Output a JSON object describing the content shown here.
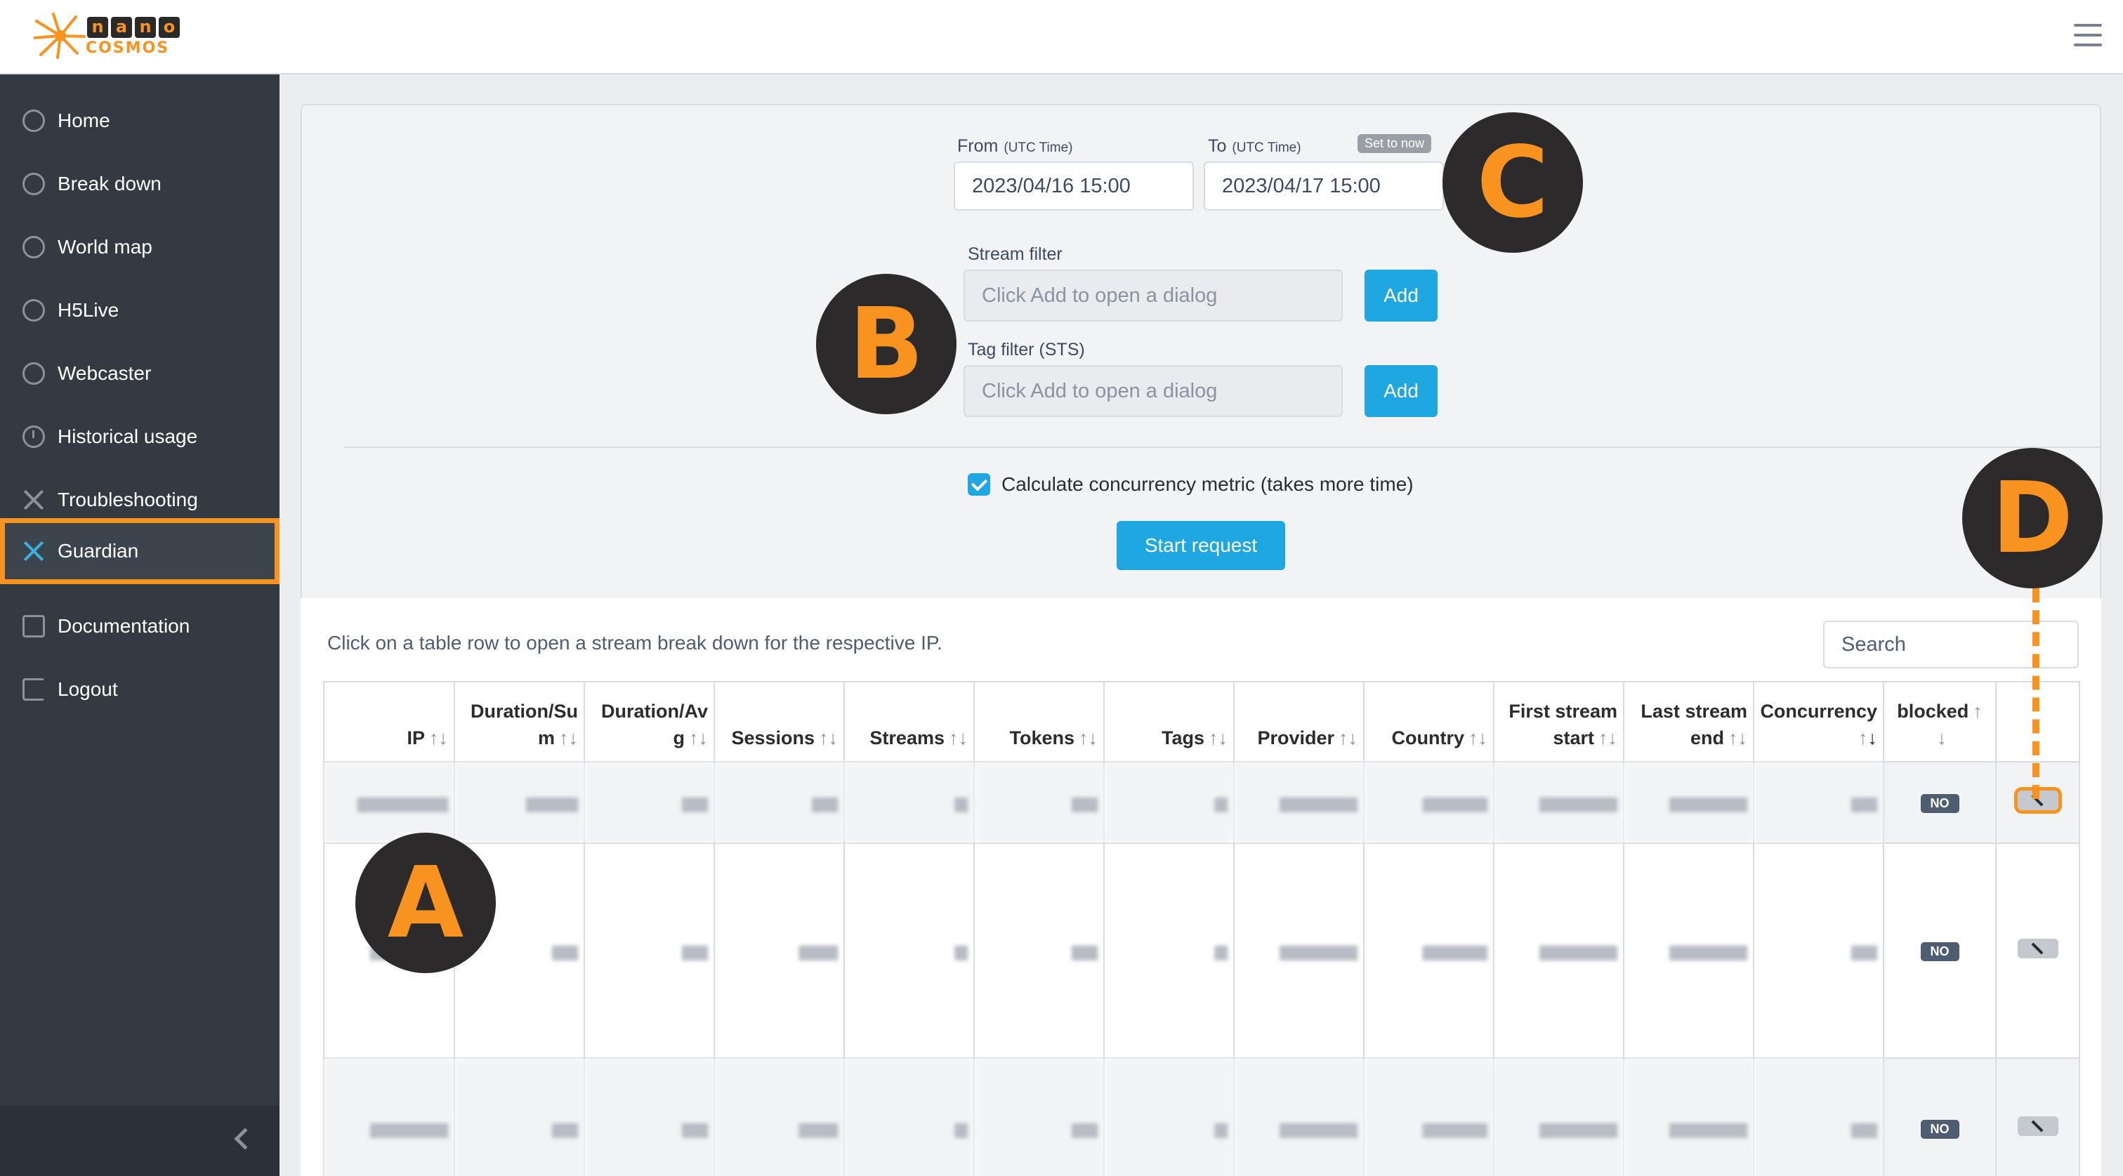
{
  "brand": {
    "logo_top": "nano",
    "logo_bottom": "COSMOS",
    "accent": "#f7931e",
    "primary": "#1ea7e1"
  },
  "header": {
    "menu_icon": "hamburger-icon"
  },
  "sidebar": {
    "items": [
      {
        "label": "Home",
        "icon": "dashboard-icon"
      },
      {
        "label": "Break down",
        "icon": "dashboard-icon"
      },
      {
        "label": "World map",
        "icon": "dashboard-icon"
      },
      {
        "label": "H5Live",
        "icon": "dashboard-icon"
      },
      {
        "label": "Webcaster",
        "icon": "dashboard-icon"
      },
      {
        "label": "Historical usage",
        "icon": "clock-icon"
      },
      {
        "label": "Troubleshooting",
        "icon": "tools-icon"
      },
      {
        "label": "Guardian",
        "icon": "tools-icon",
        "active": true
      },
      {
        "label": "Documentation",
        "icon": "document-icon"
      },
      {
        "label": "Logout",
        "icon": "logout-icon"
      }
    ],
    "collapse_icon": "chevron-left-icon"
  },
  "filters": {
    "from_label": "From",
    "from_hint": "(UTC Time)",
    "from_value": "2023/04/16 15:00",
    "to_label": "To",
    "to_hint": "(UTC Time)",
    "to_value": "2023/04/17 15:00",
    "set_to_now": "Set to now",
    "stream_filter_label": "Stream filter",
    "stream_filter_placeholder": "Click Add to open a dialog",
    "tag_filter_label": "Tag filter (STS)",
    "tag_filter_placeholder": "Click Add to open a dialog",
    "add_label": "Add",
    "concurrency_label": "Calculate concurrency metric (takes more time)",
    "concurrency_checked": true,
    "start_label": "Start request"
  },
  "table": {
    "hint": "Click on a table row to open a stream break down for the respective IP.",
    "search_placeholder": "Search",
    "headers": [
      "IP",
      "Duration/Sum",
      "Duration/Avg",
      "Sessions",
      "Streams",
      "Tokens",
      "Tags",
      "Provider",
      "Country",
      "First stream start",
      "Last stream end",
      "Concurrency",
      "blocked",
      ""
    ],
    "header_lines": [
      [
        "IP"
      ],
      [
        "Duration/Su",
        "m"
      ],
      [
        "Duration/Av",
        "g"
      ],
      [
        "Sessions"
      ],
      [
        "Streams"
      ],
      [
        "Tokens"
      ],
      [
        "Tags"
      ],
      [
        "Provider"
      ],
      [
        "Country"
      ],
      [
        "First stream",
        "start"
      ],
      [
        "Last stream",
        "end"
      ],
      [
        "Concurrency"
      ],
      [
        "blocked"
      ],
      []
    ],
    "blocked_value": "NO",
    "action_icon": "wrench-icon"
  },
  "callouts": [
    "A",
    "B",
    "C",
    "D"
  ]
}
